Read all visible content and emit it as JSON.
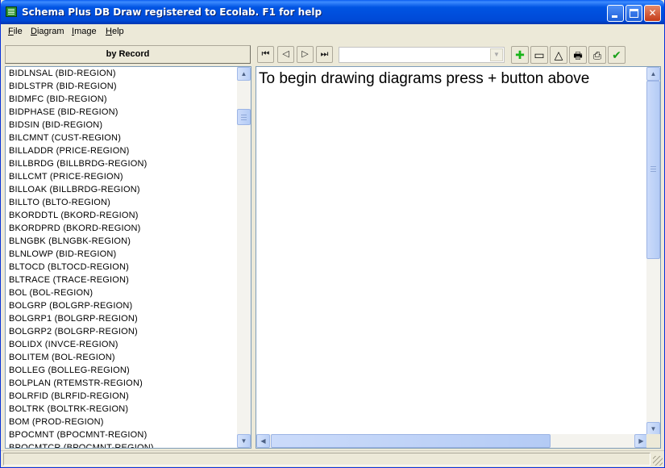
{
  "window": {
    "title": "Schema Plus DB Draw registered to Ecolab.  F1 for help",
    "controls": {
      "minimize": "minimize",
      "maximize": "maximize",
      "close": "✕"
    }
  },
  "menu": [
    {
      "label": "File",
      "mnemonic": "F",
      "rest": "ile"
    },
    {
      "label": "Diagram",
      "mnemonic": "D",
      "rest": "iagram"
    },
    {
      "label": "Image",
      "mnemonic": "I",
      "rest": "mage"
    },
    {
      "label": "Help",
      "mnemonic": "H",
      "rest": "elp"
    }
  ],
  "left_panel": {
    "header": "by Record",
    "items": [
      "BIDLNSAL  (BID-REGION)",
      "BIDLSTPR  (BID-REGION)",
      "BIDMFC  (BID-REGION)",
      "BIDPHASE  (BID-REGION)",
      "BIDSIN  (BID-REGION)",
      "BILCMNT  (CUST-REGION)",
      "BILLADDR  (PRICE-REGION)",
      "BILLBRDG  (BILLBRDG-REGION)",
      "BILLCMT  (PRICE-REGION)",
      "BILLOAK  (BILLBRDG-REGION)",
      "BILLTO  (BLTO-REGION)",
      "BKORDDTL  (BKORD-REGION)",
      "BKORDPRD  (BKORD-REGION)",
      "BLNGBK  (BLNGBK-REGION)",
      "BLNLOWP  (BID-REGION)",
      "BLTOCD  (BLTOCD-REGION)",
      "BLTRACE  (TRACE-REGION)",
      "BOL  (BOL-REGION)",
      "BOLGRP  (BOLGRP-REGION)",
      "BOLGRP1  (BOLGRP-REGION)",
      "BOLGRP2  (BOLGRP-REGION)",
      "BOLIDX  (INVCE-REGION)",
      "BOLITEM  (BOL-REGION)",
      "BOLLEG  (BOLLEG-REGION)",
      "BOLPLAN  (RTEMSTR-REGION)",
      "BOLRFID  (BLRFID-REGION)",
      "BOLTRK  (BOLTRK-REGION)",
      "BOM  (PROD-REGION)",
      "BPOCMNT  (BPOCMNT-REGION)",
      "BPOCMTCR  (BPOCMNT-REGION)"
    ]
  },
  "toolbar": {
    "nav": [
      "first-icon",
      "prev-icon",
      "next-icon",
      "last-icon"
    ],
    "nav_glyphs": [
      "⏮",
      "◁",
      "▷",
      "⏭"
    ],
    "diagram_select": "",
    "tools": [
      {
        "icon": "add-icon",
        "glyph": "✚",
        "color": "#18b418"
      },
      {
        "icon": "remove-icon",
        "glyph": "▭",
        "color": "#000000"
      },
      {
        "icon": "triangle-icon",
        "glyph": "△",
        "color": "#000000"
      },
      {
        "icon": "printer-setup-icon",
        "glyph": "🖶",
        "color": "#000000"
      },
      {
        "icon": "print-icon",
        "glyph": "⎙",
        "color": "#000000"
      },
      {
        "icon": "check-icon",
        "glyph": "✔",
        "color": "#18a018"
      }
    ]
  },
  "canvas": {
    "message": "To begin drawing diagrams press + button above"
  },
  "colors": {
    "titlebar": "#0054e3",
    "chrome": "#ece9d8",
    "border": "#7f9db9"
  }
}
